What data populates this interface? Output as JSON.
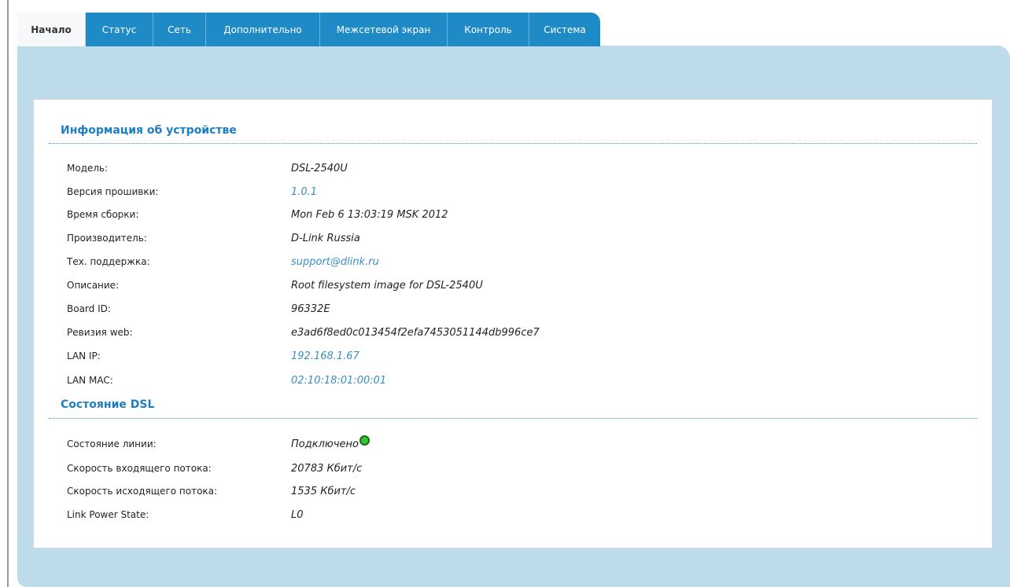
{
  "tabs": [
    {
      "label": "Начало",
      "active": true
    },
    {
      "label": "Статус"
    },
    {
      "label": "Сеть"
    },
    {
      "label": "Дополнительно"
    },
    {
      "label": "Межсетевой экран"
    },
    {
      "label": "Контроль"
    },
    {
      "label": "Система"
    }
  ],
  "device_info": {
    "title": "Информация об устройстве",
    "rows": [
      {
        "label": "Модель:",
        "value": "DSL-2540U"
      },
      {
        "label": "Версия прошивки:",
        "value": "1.0.1"
      },
      {
        "label": "Время сборки:",
        "value": "Mon Feb 6 13:03:19 MSK 2012"
      },
      {
        "label": "Производитель:",
        "value": "D-Link Russia"
      },
      {
        "label": "Тех. поддержка:",
        "value": "support@dlink.ru"
      },
      {
        "label": "Описание:",
        "value": "Root filesystem image for DSL-2540U"
      },
      {
        "label": "Board ID:",
        "value": "96332E"
      },
      {
        "label": "Ревизия web:",
        "value": "e3ad6f8ed0c013454f2efa7453051144db996ce7"
      },
      {
        "label": "LAN IP:",
        "value": "192.168.1.67"
      },
      {
        "label": "LAN MAC:",
        "value": "02:10:18:01:00:01"
      }
    ]
  },
  "dsl_status": {
    "title": "Состояние DSL",
    "rows": [
      {
        "label": "Состояние линии:",
        "value": "Подключено"
      },
      {
        "label": "Скорость входящего потока:",
        "value": "20783 Кбит/с"
      },
      {
        "label": "Скорость исходящего потока:",
        "value": "1535 Кбит/с"
      },
      {
        "label": "Link Power State:",
        "value": "L0"
      }
    ]
  },
  "colors": {
    "tab_blue": "#1e8ac6",
    "panel_blue": "#bedbeb",
    "title_blue": "#1d7fc0",
    "link_blue": "#3b8ec2",
    "status_green": "#38c238"
  },
  "icons": {
    "line_status": "status-indicator-green-icon"
  }
}
